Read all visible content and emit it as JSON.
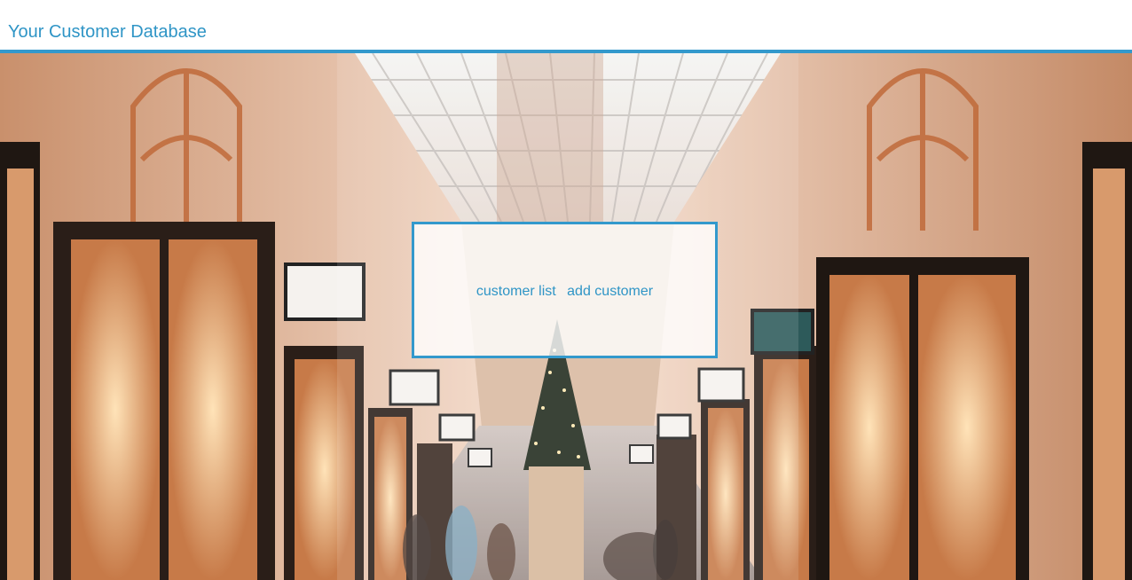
{
  "header": {
    "title": "Your Customer Database"
  },
  "hero": {
    "image_description_icon": "shopping-arcade-photo"
  },
  "nav": {
    "links": [
      {
        "label": "customer list"
      },
      {
        "label": "add customer"
      }
    ]
  },
  "colors": {
    "accent": "#3399cc",
    "link": "#2f95c6"
  }
}
